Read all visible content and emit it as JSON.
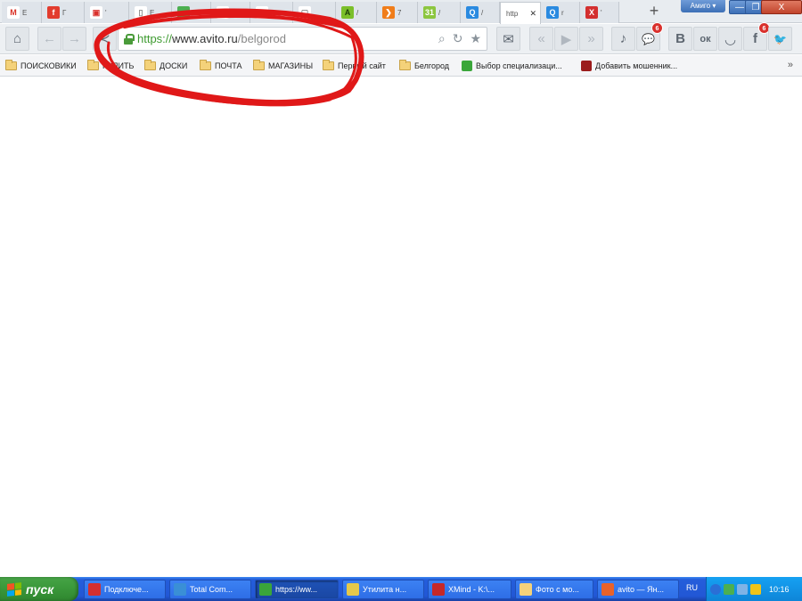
{
  "tabs": [
    {
      "glyph": "M",
      "title": "E",
      "color": "#ffffff",
      "glyph_color": "#d93025"
    },
    {
      "glyph": "f",
      "title": "Г",
      "color": "#e23c2e",
      "glyph_color": "#ffffff"
    },
    {
      "glyph": "▣",
      "title": "'",
      "color": "#ffffff",
      "glyph_color": "#d9302c"
    },
    {
      "glyph": "▯",
      "title": "Е",
      "color": "#ffffff",
      "glyph_color": "#888888"
    },
    {
      "glyph": "◔",
      "title": "",
      "color": "#4caf50",
      "glyph_color": "#ffffff"
    },
    {
      "glyph": "✉",
      "title": "",
      "color": "#ffffff",
      "glyph_color": "#888888"
    },
    {
      "glyph": "▲",
      "title": "",
      "color": "#ffffff",
      "glyph_color": "#2a7fd4"
    },
    {
      "glyph": "▢",
      "title": "",
      "color": "#ffffff",
      "glyph_color": "#888888"
    },
    {
      "glyph": "A",
      "title": "/",
      "color": "#7bbf2a",
      "glyph_color": "#1d3f0a"
    },
    {
      "glyph": "❯",
      "title": "7",
      "color": "#f07d1a",
      "glyph_color": "#ffffff"
    },
    {
      "glyph": "31",
      "title": "/",
      "color": "#8cc63f",
      "glyph_color": "#ffffff"
    },
    {
      "glyph": "Q",
      "title": "/",
      "color": "#2a8ae0",
      "glyph_color": "#ffffff"
    },
    {
      "glyph": "",
      "title": "http",
      "color": "#ffffff",
      "glyph_color": "#333333",
      "active": true,
      "close": "✕"
    },
    {
      "glyph": "Q",
      "title": "r",
      "color": "#2a8ae0",
      "glyph_color": "#ffffff"
    },
    {
      "glyph": "X",
      "title": "'",
      "color": "#d32f2f",
      "glyph_color": "#ffffff"
    }
  ],
  "new_tab_label": "+",
  "account_label": "Амиго ▾",
  "window_controls": {
    "minimize": "—",
    "restore": "❐",
    "close": "X"
  },
  "toolbar": {
    "home_icon": "⌂",
    "back_icon": "←",
    "forward_icon": "→",
    "share_icon": "≺",
    "mail_icon": "✉",
    "prev_icon": "«",
    "play_icon": "▶",
    "next_icon": "»",
    "music_icon": "♪",
    "chat_icon": "💬",
    "chat_badge": "6",
    "vk_label": "В",
    "ok_label": "ок",
    "mymail_label": "◡",
    "fb_label": "f",
    "fb_badge": "6",
    "tw_label": "🐦"
  },
  "address": {
    "protocol": "https://",
    "host": "www.avito.ru",
    "path": "/belgorod",
    "search_icon": "⌕",
    "reload_icon": "↻",
    "star_icon": "★"
  },
  "bookmarks": [
    {
      "label": "ПОИСКОВИКИ",
      "kind": "folder"
    },
    {
      "label": "КУПИТЬ",
      "kind": "folder"
    },
    {
      "label": "ДОСКИ",
      "kind": "folder"
    },
    {
      "label": "ПОЧТА",
      "kind": "folder"
    },
    {
      "label": "МАГАЗИНЫ",
      "kind": "folder"
    },
    {
      "label": "Первый сайт",
      "kind": "folder"
    },
    {
      "label": "Белгород",
      "kind": "folder"
    },
    {
      "label": "Выбор специализаци...",
      "kind": "link",
      "color": "#3aa63a"
    },
    {
      "label": "Добавить мошенник...",
      "kind": "link",
      "color": "#9b1c1c"
    }
  ],
  "bookmarks_more": "»",
  "taskbar": {
    "start_label": "пуск",
    "tasks": [
      {
        "label": "Подключе...",
        "color": "#d32f2f"
      },
      {
        "label": "Total Com...",
        "color": "#3a8fd6"
      },
      {
        "label": "https://ww...",
        "color": "#3aa63a",
        "active": true
      },
      {
        "label": "Утилита н...",
        "color": "#e6c84a"
      },
      {
        "label": "XMind - K:\\...",
        "color": "#c62828"
      },
      {
        "label": "Фото с мо...",
        "color": "#f4d27a"
      },
      {
        "label": "avito — Ян...",
        "color": "#e8622a"
      }
    ],
    "lang": "RU",
    "clock": "10:16"
  },
  "annotation_color": "#e01818"
}
